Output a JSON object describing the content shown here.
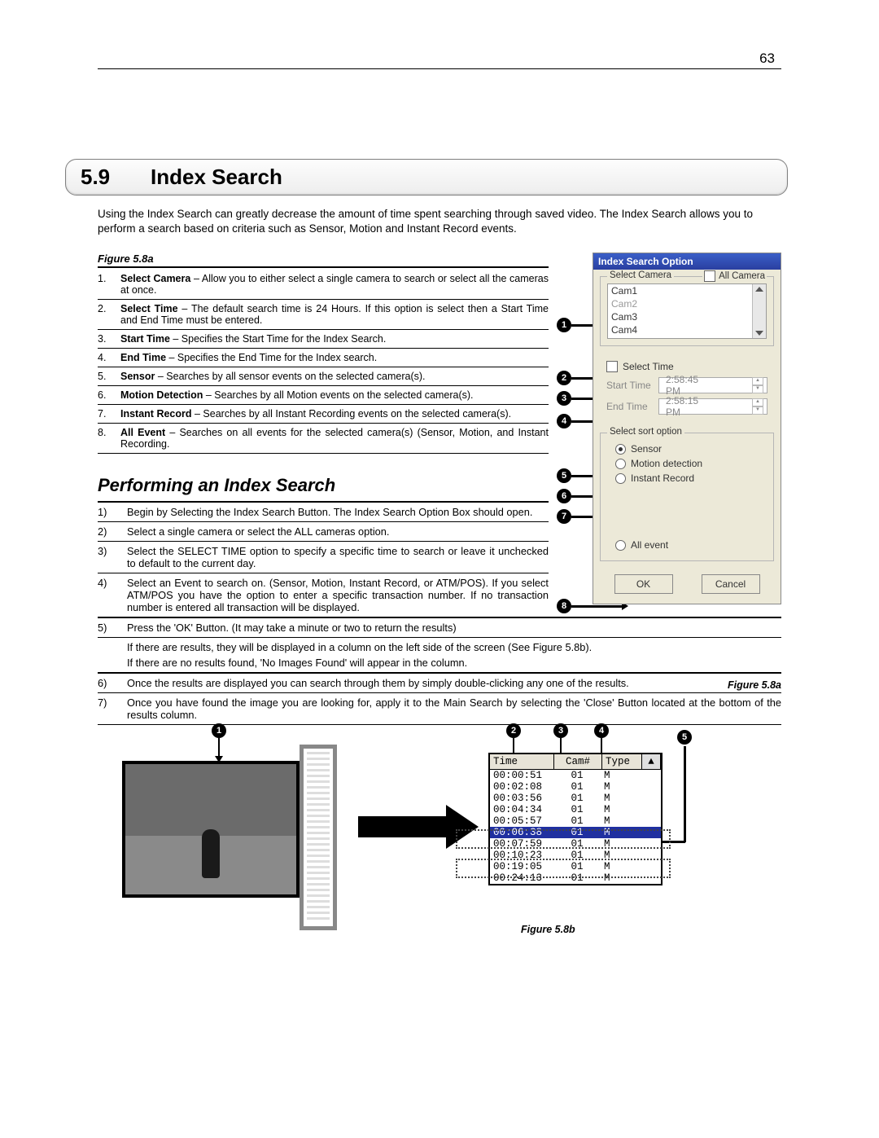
{
  "page_number": "63",
  "section": {
    "number": "5.9",
    "title": "Index Search"
  },
  "intro": "Using the Index Search can greatly decrease the amount of time spent searching through saved video. The Index Search allows you to perform a search based on criteria such as Sensor, Motion and Instant Record events.",
  "fig_a_label": "Figure 5.8a",
  "definitions": [
    {
      "n": "1.",
      "term": "Select Camera",
      "desc": " – Allow you to either select a single camera to search or select all the cameras at once."
    },
    {
      "n": "2.",
      "term": "Select Time",
      "desc": " – The default search time is 24 Hours.  If this option is select then a Start Time and End Time must be entered."
    },
    {
      "n": "3.",
      "term": "Start Time",
      "desc": " – Specifies the Start Time for the Index Search."
    },
    {
      "n": "4.",
      "term": "End Time",
      "desc": " – Specifies the End Time for the Index search."
    },
    {
      "n": "5.",
      "term": "Sensor",
      "desc": " – Searches by all sensor events on the selected camera(s)."
    },
    {
      "n": "6.",
      "term": "Motion Detection",
      "desc": " – Searches by all Motion events on the selected camera(s)."
    },
    {
      "n": "7.",
      "term": "Instant Record",
      "desc": " – Searches by all Instant Recording events on the selected camera(s)."
    },
    {
      "n": "8.",
      "term": "All Event",
      "desc": " – Searches on all events for the selected camera(s) (Sensor, Motion, and Instant Recording."
    }
  ],
  "subhead": "Performing an Index Search",
  "steps_top": [
    {
      "n": "1)",
      "t": "Begin by Selecting the Index Search Button. The Index Search Option Box should open."
    },
    {
      "n": "2)",
      "t": "Select a single camera or select the ALL cameras option."
    },
    {
      "n": "3)",
      "t": "Select the SELECT TIME option to specify a specific time to search or leave it unchecked to default to the current day."
    },
    {
      "n": "4)",
      "t": "Select an Event to search on. (Sensor, Motion, Instant Record, or ATM/POS). If you select ATM/POS you have the option to enter a specific transaction number. If no transaction number is entered all transaction will be displayed."
    }
  ],
  "steps_bottom": [
    {
      "n": "5)",
      "t": "Press the 'OK' Button. (It may take a minute or two to return the results)"
    }
  ],
  "notes": [
    "If there are results, they will be displayed in a column on the left side of the screen (See Figure 5.8b).",
    "If there are no results found, 'No Images Found' will appear in the column."
  ],
  "steps_after": [
    {
      "n": "6)",
      "t": "Once the results are displayed you can search through them by simply double-clicking any one of the results."
    },
    {
      "n": "7)",
      "t": "Once you have found the image you are looking for, apply it to the Main Search by selecting the 'Close' Button located at the bottom of the results column."
    }
  ],
  "dialog": {
    "title": "Index Search Option",
    "select_camera_legend": "Select Camera",
    "all_camera": "All Camera",
    "cams": [
      "Cam1",
      "Cam2",
      "Cam3",
      "Cam4"
    ],
    "select_time": "Select Time",
    "start_time_label": "Start Time",
    "start_time_value": "2:58:45 PM",
    "end_time_label": "End Time",
    "end_time_value": "2:58:15 PM",
    "sort_legend": "Select sort option",
    "sort": {
      "sensor": "Sensor",
      "motion": "Motion detection",
      "instant": "Instant Record"
    },
    "all_event": "All event",
    "ok": "OK",
    "cancel": "Cancel",
    "fig_caption": "Figure 5.8a"
  },
  "callouts_a": [
    "1",
    "2",
    "3",
    "4",
    "5",
    "6",
    "7",
    "8"
  ],
  "bottom": {
    "callouts": [
      "1",
      "2",
      "3",
      "4",
      "5"
    ],
    "grid_headers": [
      "Time",
      "Cam#",
      "Type"
    ],
    "rows": [
      {
        "time": "00:00:51",
        "cam": "01",
        "type": "M"
      },
      {
        "time": "00:02:08",
        "cam": "01",
        "type": "M"
      },
      {
        "time": "00:03:56",
        "cam": "01",
        "type": "M"
      },
      {
        "time": "00:04:34",
        "cam": "01",
        "type": "M"
      },
      {
        "time": "00:05:57",
        "cam": "01",
        "type": "M"
      },
      {
        "time": "00:06:38",
        "cam": "01",
        "type": "M"
      },
      {
        "time": "00:07:59",
        "cam": "01",
        "type": "M"
      },
      {
        "time": "00:10:23",
        "cam": "01",
        "type": "M"
      },
      {
        "time": "00:19:05",
        "cam": "01",
        "type": "M"
      },
      {
        "time": "00:24:13",
        "cam": "01",
        "type": "M"
      }
    ],
    "caption": "Figure 5.8b"
  }
}
